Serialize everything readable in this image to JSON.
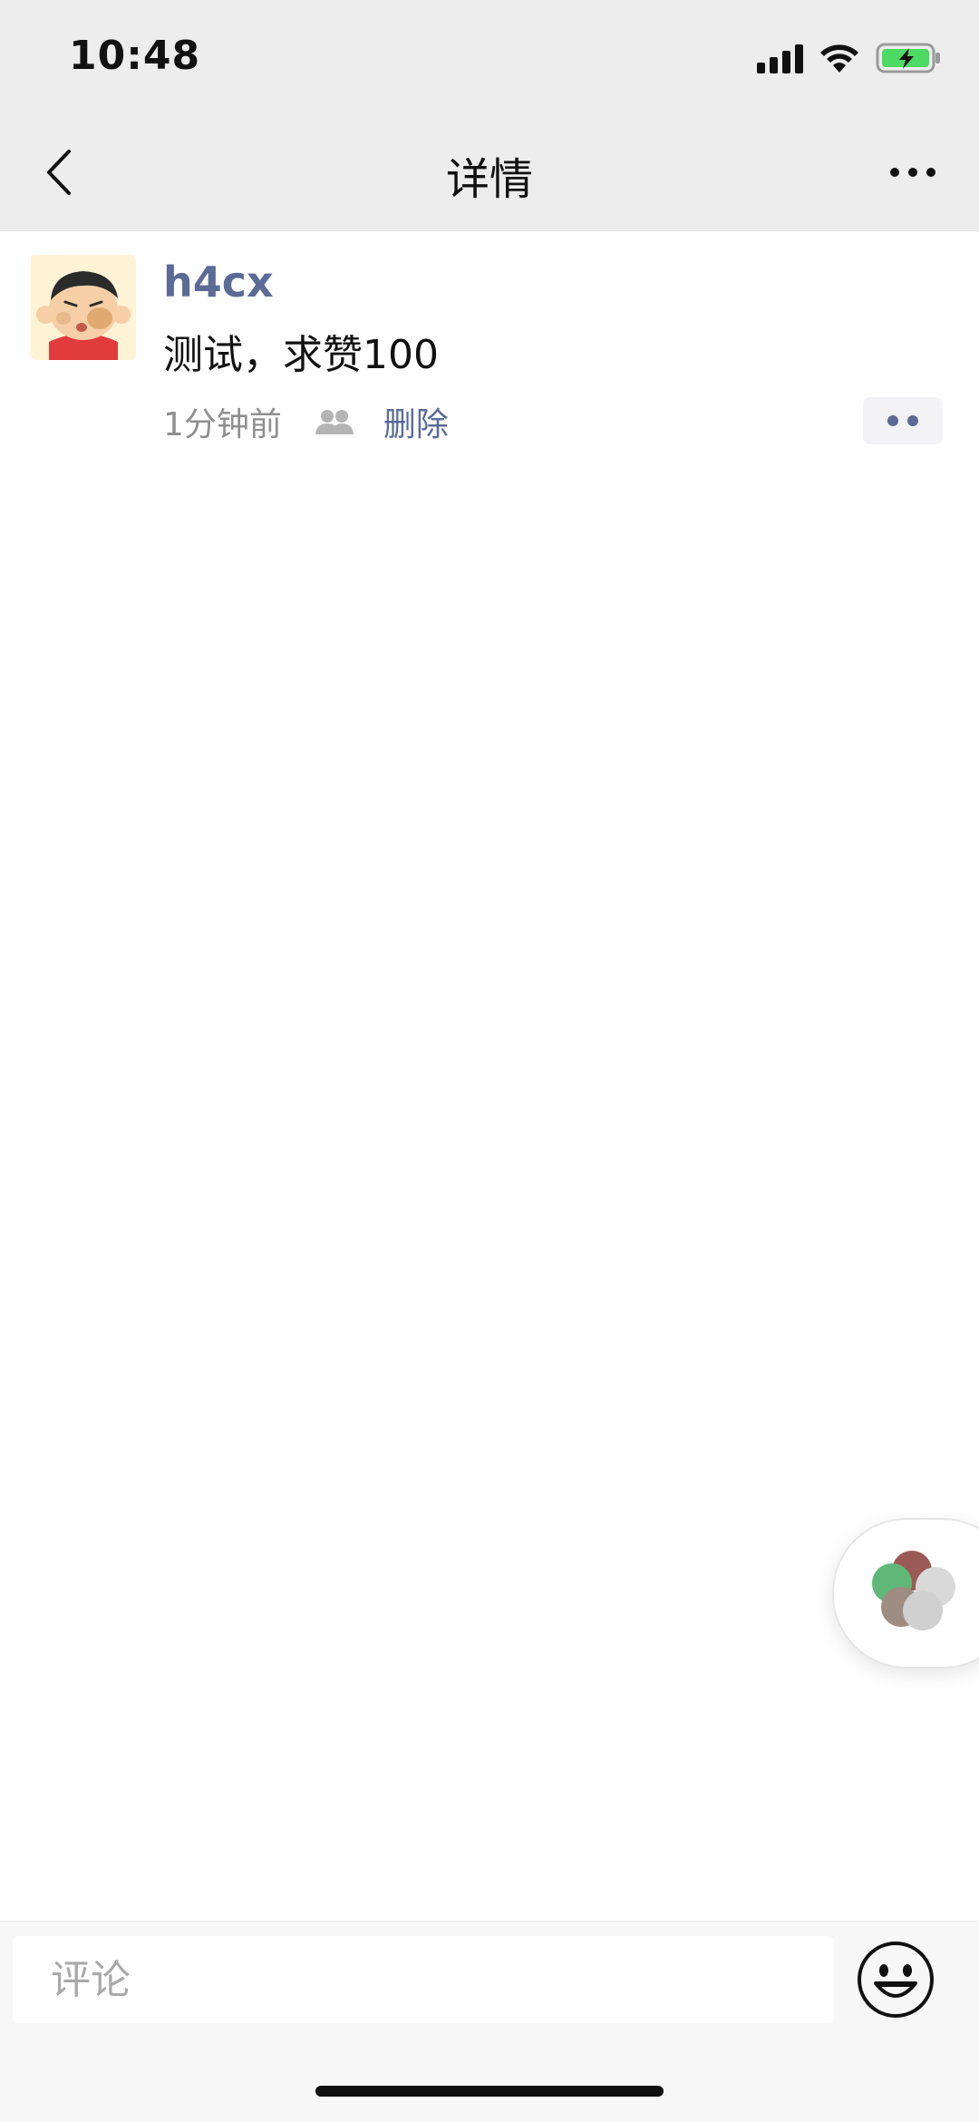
{
  "status_bar": {
    "time": "10:48",
    "signal_icon": "cellular-signal-icon",
    "wifi_icon": "wifi-icon",
    "battery_icon": "battery-charging-icon",
    "battery_color": "#4cd964"
  },
  "nav": {
    "title": "详情",
    "back_icon": "chevron-left-icon",
    "more_icon": "ellipsis-icon"
  },
  "post": {
    "author": "h4cx",
    "text": "测试，求赞100",
    "time": "1分钟前",
    "visibility_icon": "friends-icon",
    "delete_label": "删除",
    "action_icon": "two-dots-icon"
  },
  "comment": {
    "placeholder": "评论",
    "emoji_icon": "smiley-emoji-icon"
  },
  "colors": {
    "link": "#5b6b96",
    "nav_bg": "#ededed",
    "meta_text": "#8f8f8f"
  }
}
